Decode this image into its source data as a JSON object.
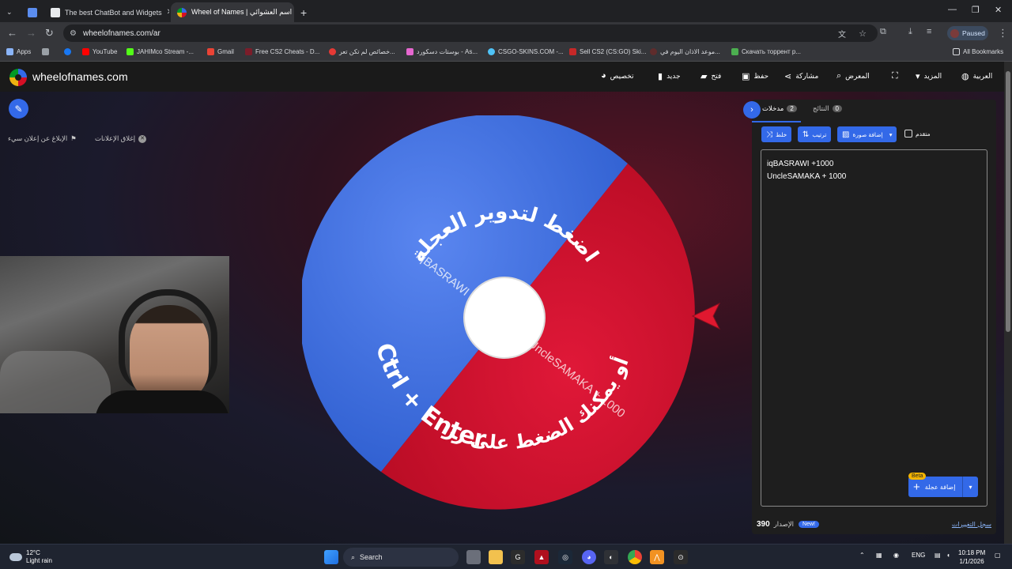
{
  "browser": {
    "tabs": [
      {
        "title": "The best ChatBot and Widgets"
      },
      {
        "title": "Wheel of Names | اسم العشوائي"
      }
    ],
    "url": "wheelofnames.com/ar",
    "profile_status": "Paused",
    "bookmarks": [
      "Apps",
      "YouTube",
      "JAHIMco Stream -...",
      "Gmail",
      "Free CS2 Cheats - D...",
      "خصائص لم تكن تعر...",
      "بوستات دسكورد - As...",
      "CSGO-SKINS.COM -...",
      "Sell CS2 (CS:GO) Ski...",
      "موعد الاذان اليوم في...",
      "Скачать торрент р..."
    ],
    "all_bookmarks": "All Bookmarks"
  },
  "site": {
    "name": "wheelofnames.com",
    "menu": {
      "customize": "تخصيص",
      "new": "جديد",
      "open": "فتح",
      "save": "حفظ",
      "share": "مشاركة",
      "gallery": "المعرض",
      "more": "المزيد",
      "language": "العربية"
    },
    "close_ads": "إغلاق الإعلانات",
    "report_ad": "الإبلاغ عن إعلان سيء"
  },
  "wheel": {
    "instruction_top": "اضغط لتدوير العجلة",
    "instruction_bottom_1": "أو يمكنك الضغط على زر",
    "instruction_bottom_2": "Ctrl + Enter",
    "segments": [
      {
        "label": "iqBASRAWI +1000",
        "color": "#3d6fe0"
      },
      {
        "label": "UncleSAMAKA + 1000",
        "color": "#d0102c"
      }
    ]
  },
  "panel": {
    "tab_entries": "مدخلات",
    "tab_entries_count": "2",
    "tab_results": "النتائج",
    "tab_results_count": "0",
    "btn_shuffle": "خلط",
    "btn_sort": "ترتيب",
    "btn_add_image": "إضافة صورة",
    "advanced": "متقدم",
    "entries": [
      "iqBASRAWI +1000",
      "UncleSAMAKA + 1000"
    ],
    "add_wheel": "إضافة عجلة",
    "beta": "Beta",
    "version_number": "390",
    "version_label": "الإصدار",
    "new_badge": "New!",
    "changelog": "سجل التغييرات"
  },
  "taskbar": {
    "temperature": "12°C",
    "weather": "Light rain",
    "search": "Search",
    "language": "ENG",
    "time": "10:18 PM",
    "date": "1/1/2026"
  }
}
